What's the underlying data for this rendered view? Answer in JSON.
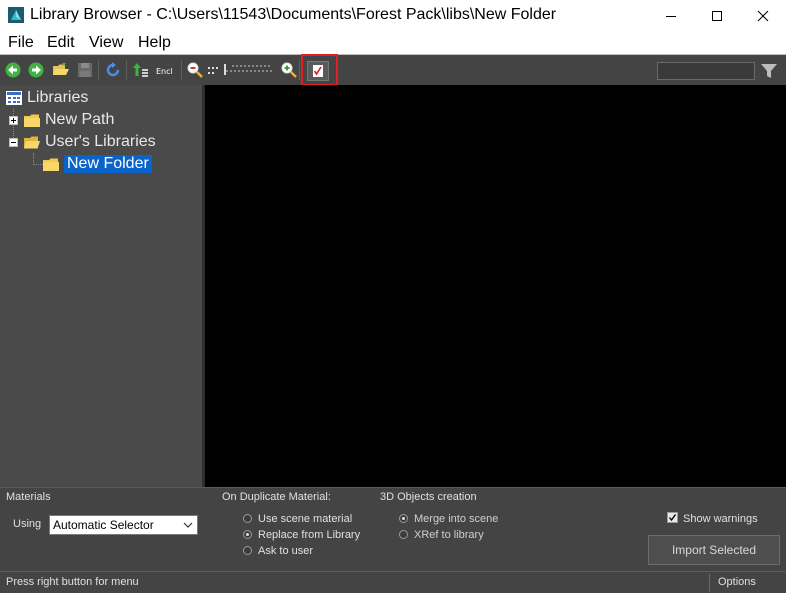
{
  "window": {
    "title": "Library Browser - C:\\Users\\11543\\Documents\\Forest Pack\\libs\\New Folder"
  },
  "menu": [
    "File",
    "Edit",
    "View",
    "Help"
  ],
  "toolbar": {
    "buttons": [
      "back-icon",
      "forward-icon",
      "open-folder-icon",
      "save-icon",
      "refresh-icon",
      "sort-icon",
      "encoding-icon",
      "zoom-out-icon",
      "zoom-slider",
      "zoom-in-icon",
      "checklist-icon"
    ],
    "encoding_label": "Encl",
    "search_placeholder": "",
    "filter_icon": "filter-icon"
  },
  "tree": {
    "root": "Libraries",
    "items": [
      {
        "label": "New Path",
        "expander": "+"
      },
      {
        "label": "User's Libraries",
        "expander": "-"
      },
      {
        "label": "New Folder",
        "selected": true
      }
    ]
  },
  "options": {
    "materials_header": "Materials",
    "using_label": "Using",
    "using_value": "Automatic Selector",
    "duplicate_header": "On Duplicate Material:",
    "duplicate_options": [
      {
        "label": "Use scene material",
        "selected": false
      },
      {
        "label": "Replace from Library",
        "selected": true
      },
      {
        "label": "Ask to user",
        "selected": false
      }
    ],
    "objects_header": "3D Objects creation",
    "objects_options": [
      {
        "label": "Merge into scene",
        "selected": true
      },
      {
        "label": "XRef to library",
        "selected": false
      }
    ],
    "show_warnings_label": "Show warnings",
    "show_warnings_checked": true,
    "import_button": "Import Selected"
  },
  "status": {
    "text": "Press right button for menu",
    "options_button": "Options"
  },
  "colors": {
    "panel_bg": "#444444",
    "tree_bg": "#4a4a4a",
    "selection": "#0a63c9",
    "highlight_box": "#e02020",
    "content_bg": "#000000"
  }
}
